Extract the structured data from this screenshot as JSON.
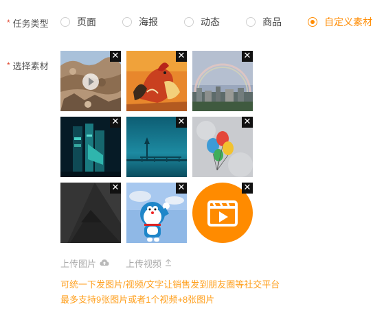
{
  "task_type": {
    "label": "任务类型",
    "options": [
      {
        "label": "页面",
        "checked": false
      },
      {
        "label": "海报",
        "checked": false
      },
      {
        "label": "动态",
        "checked": false
      },
      {
        "label": "商品",
        "checked": false
      },
      {
        "label": "自定义素材",
        "checked": true
      }
    ]
  },
  "materials": {
    "label": "选择素材",
    "items": [
      {
        "kind": "video",
        "icon": "rock-landscape-image"
      },
      {
        "kind": "image",
        "icon": "rooster-painting-image"
      },
      {
        "kind": "image",
        "icon": "rainbow-city-image"
      },
      {
        "kind": "image",
        "icon": "teal-glass-building-image"
      },
      {
        "kind": "image",
        "icon": "foggy-pier-image"
      },
      {
        "kind": "image",
        "icon": "balloons-image"
      },
      {
        "kind": "image",
        "icon": "dark-geometric-image"
      },
      {
        "kind": "image",
        "icon": "doraemon-image"
      },
      {
        "kind": "video-placeholder",
        "icon": "video-clapper-icon"
      }
    ],
    "close_symbol": "✕"
  },
  "upload": {
    "image_label": "上传图片",
    "video_label": "上传视频"
  },
  "hints": {
    "line1": "可统一下发图片/视频/文字让销售发到朋友圈等社交平台",
    "line2": "最多支持9张图片或者1个视频+8张图片"
  },
  "colors": {
    "accent": "#ff8b00",
    "hint": "#ff9f1c",
    "required": "#e0452b"
  }
}
